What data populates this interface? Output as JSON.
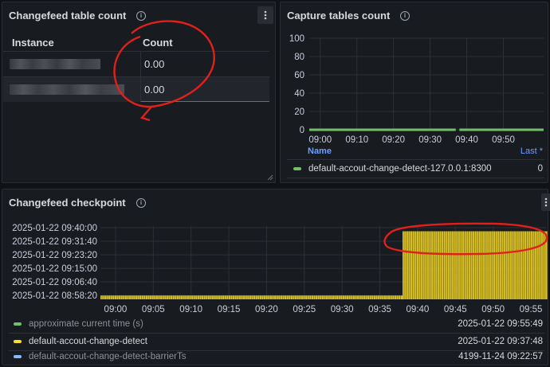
{
  "table_panel": {
    "title": "Changefeed table count",
    "columns": [
      "Instance",
      "Count"
    ],
    "rows": [
      {
        "instance": "",
        "count": "0.00"
      },
      {
        "instance": "",
        "count": "0.00"
      }
    ]
  },
  "capture_panel": {
    "title": "Capture tables count",
    "legend_header": {
      "name": "Name",
      "last": "Last *"
    },
    "legend_items": [
      {
        "name": "default-accout-change-detect-127.0.0.1:8300",
        "value": "0",
        "color": "#73bf69"
      }
    ]
  },
  "checkpoint_panel": {
    "title": "Changefeed checkpoint",
    "legend_items": [
      {
        "name": "approximate current time (s)",
        "value": "2025-01-22 09:55:49",
        "color": "#73bf69"
      },
      {
        "name": "default-accout-change-detect",
        "value": "2025-01-22 09:37:48",
        "color": "#fade2a"
      },
      {
        "name": "default-accout-change-detect-barrierTs",
        "value": "4199-11-24 09:22:57",
        "color": "#8ab8ff"
      }
    ]
  },
  "chart_data": [
    {
      "type": "line",
      "ylim": [
        0,
        100
      ],
      "y_ticks": [
        "100",
        "80",
        "60",
        "40",
        "20",
        "0"
      ],
      "x_ticks": [
        "09:00",
        "09:10",
        "09:20",
        "09:30",
        "09:40",
        "09:50"
      ],
      "xlim": [
        "08:57",
        "10:01"
      ],
      "series": [
        {
          "name": "default-accout-change-detect-127.0.0.1:8300",
          "color": "#73bf69",
          "segments": [
            {
              "x": [
                "08:57",
                "09:37"
              ],
              "y": 0
            },
            {
              "x": [
                "09:38",
                "10:01"
              ],
              "y": 0
            }
          ]
        }
      ]
    },
    {
      "type": "bar",
      "y_ticks": [
        "2025-01-22 09:40:00",
        "2025-01-22 09:31:40",
        "2025-01-22 09:23:20",
        "2025-01-22 09:15:00",
        "2025-01-22 09:06:40",
        "2025-01-22 08:58:20"
      ],
      "x_ticks": [
        "09:00",
        "09:05",
        "09:10",
        "09:15",
        "09:20",
        "09:25",
        "09:30",
        "09:35",
        "09:40",
        "09:45",
        "09:50",
        "09:55"
      ],
      "xlim": [
        "08:58",
        "09:57"
      ],
      "ylim": [
        "2025-01-22 08:56:00",
        "2025-01-22 09:40:00"
      ],
      "series": [
        {
          "name": "default-accout-change-detect",
          "color": "#fade2a",
          "segments": [
            {
              "x": [
                "08:58",
                "09:37"
              ],
              "y": "2025-01-22 08:58:20"
            },
            {
              "x": [
                "09:38",
                "09:57"
              ],
              "y": "2025-01-22 09:37:48"
            }
          ]
        }
      ]
    }
  ]
}
